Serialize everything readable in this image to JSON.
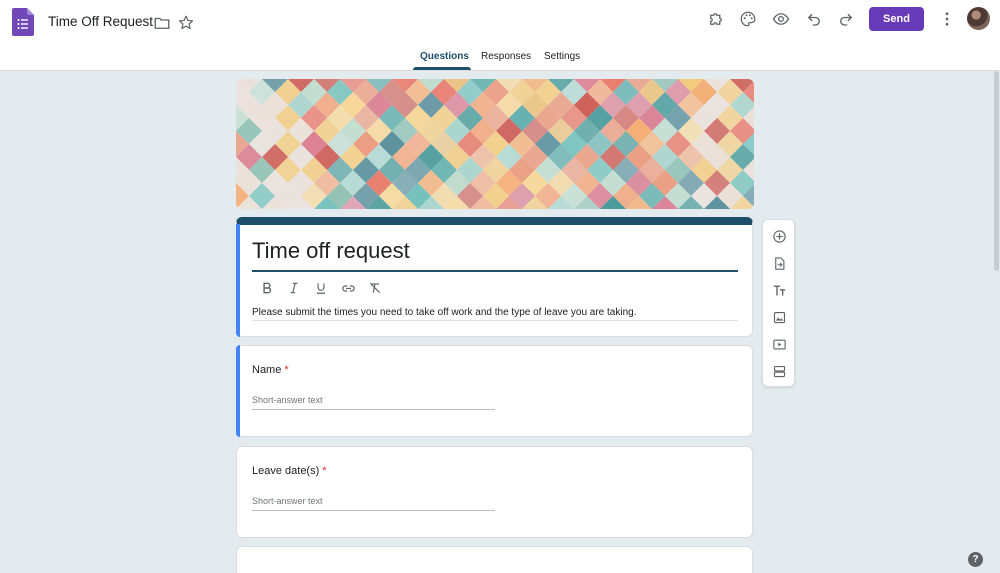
{
  "app": {
    "doc_title": "Time Off Request",
    "icons": [
      "forms-app-icon",
      "folder-icon",
      "star-icon",
      "addon-puzzle-icon",
      "palette-icon",
      "preview-eye-icon",
      "undo-icon",
      "redo-icon",
      "more-vert-icon"
    ],
    "send_label": "Send",
    "accent_color": "#673ab7",
    "theme_color": "#1d4f6b"
  },
  "tabs": [
    {
      "label": "Questions",
      "active": true
    },
    {
      "label": "Responses",
      "active": false
    },
    {
      "label": "Settings",
      "active": false
    }
  ],
  "form": {
    "title": "Time off request",
    "description": "Please submit the times you need to take off work and the type of leave you are taking.",
    "format_tools": [
      "bold-icon",
      "italic-icon",
      "underline-icon",
      "link-icon",
      "clear-format-icon"
    ]
  },
  "questions": [
    {
      "label": "Name",
      "required_mark": "*",
      "placeholder": "Short-answer text"
    },
    {
      "label": "Leave date(s)",
      "required_mark": "*",
      "placeholder": "Short-answer text"
    }
  ],
  "side_toolbar": [
    "add-question-icon",
    "import-questions-icon",
    "add-title-icon",
    "add-image-icon",
    "add-video-icon",
    "add-section-icon"
  ],
  "help_label": "?"
}
